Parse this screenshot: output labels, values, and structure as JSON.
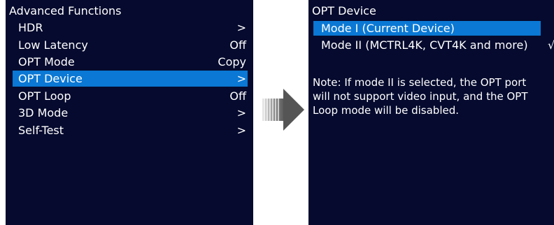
{
  "left_panel": {
    "title": "Advanced Functions",
    "items": [
      {
        "label": "HDR",
        "value": ">"
      },
      {
        "label": "Low Latency",
        "value": "Off"
      },
      {
        "label": "OPT Mode",
        "value": "Copy"
      },
      {
        "label": "OPT Device",
        "value": ">",
        "selected": true
      },
      {
        "label": "OPT Loop",
        "value": "Off"
      },
      {
        "label": "3D Mode",
        "value": ">"
      },
      {
        "label": "Self-Test",
        "value": ">"
      }
    ]
  },
  "transition_arrow": {
    "icon": "right-arrow-icon"
  },
  "right_panel": {
    "title": "OPT Device",
    "options": [
      {
        "label": "Mode I (Current Device)",
        "selected": true,
        "check": ""
      },
      {
        "label": "Mode II (MCTRL4K, CVT4K and more)",
        "selected": false,
        "check": "√"
      }
    ],
    "note_lines": [
      "Note: If mode II is selected, the OPT port",
      "will not support video input, and the OPT",
      "Loop mode will be disabled."
    ]
  },
  "colors": {
    "panel_background": "#050a2e",
    "highlight": "#0a78d4",
    "text": "#ffffff"
  }
}
